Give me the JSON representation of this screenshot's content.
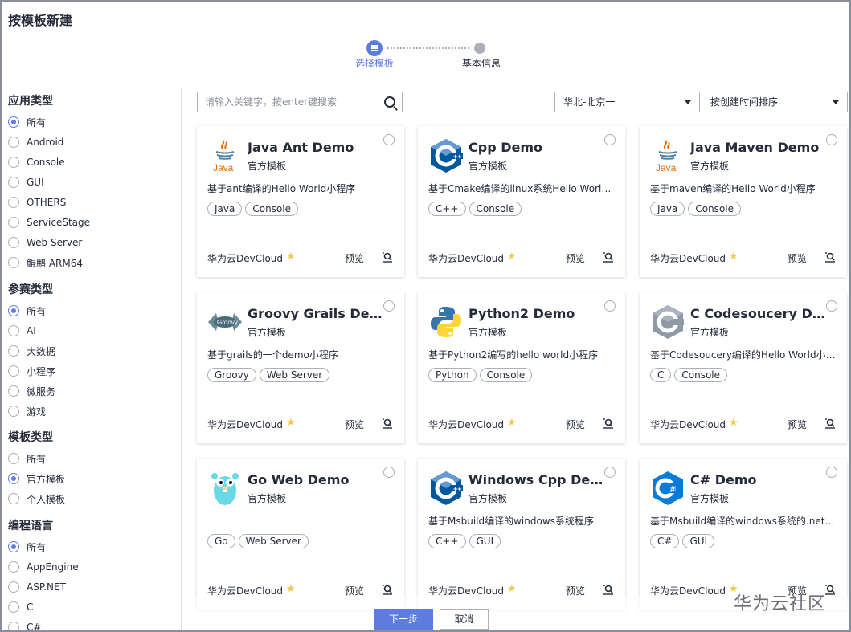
{
  "page_title": "按模板新建",
  "stepper": {
    "step1": "选择模板",
    "step2": "基本信息"
  },
  "sidebar": {
    "groups": [
      {
        "title": "应用类型",
        "items": [
          {
            "label": "所有",
            "checked": true
          },
          {
            "label": "Android",
            "checked": false
          },
          {
            "label": "Console",
            "checked": false
          },
          {
            "label": "GUI",
            "checked": false
          },
          {
            "label": "OTHERS",
            "checked": false
          },
          {
            "label": "ServiceStage",
            "checked": false
          },
          {
            "label": "Web Server",
            "checked": false
          },
          {
            "label": "鲲鹏 ARM64",
            "checked": false
          }
        ]
      },
      {
        "title": "参赛类型",
        "items": [
          {
            "label": "所有",
            "checked": true
          },
          {
            "label": "AI",
            "checked": false
          },
          {
            "label": "大数据",
            "checked": false
          },
          {
            "label": "小程序",
            "checked": false
          },
          {
            "label": "微服务",
            "checked": false
          },
          {
            "label": "游戏",
            "checked": false
          }
        ]
      },
      {
        "title": "模板类型",
        "items": [
          {
            "label": "所有",
            "checked": false
          },
          {
            "label": "官方模板",
            "checked": true
          },
          {
            "label": "个人模板",
            "checked": false
          }
        ]
      },
      {
        "title": "编程语言",
        "items": [
          {
            "label": "所有",
            "checked": true
          },
          {
            "label": "AppEngine",
            "checked": false
          },
          {
            "label": "ASP.NET",
            "checked": false
          },
          {
            "label": "C",
            "checked": false
          },
          {
            "label": "C#",
            "checked": false
          }
        ]
      }
    ]
  },
  "toolbar": {
    "search_placeholder": "请输入关键字，按enter键搜索",
    "region": "华北-北京一",
    "sort": "按创建时间排序"
  },
  "cards": [
    {
      "title": "Java Ant Demo",
      "subtitle": "官方模板",
      "desc": "基于ant编译的Hello World小程序",
      "tags": [
        "Java",
        "Console"
      ],
      "provider": "华为云DevCloud",
      "preview": "预览",
      "logo": "java-logo-icon"
    },
    {
      "title": "Cpp Demo",
      "subtitle": "官方模板",
      "desc": "基于Cmake编译的linux系统Hello World小程序",
      "tags": [
        "C++",
        "Console"
      ],
      "provider": "华为云DevCloud",
      "preview": "预览",
      "logo": "cpp-logo-icon"
    },
    {
      "title": "Java Maven Demo",
      "subtitle": "官方模板",
      "desc": "基于maven编译的Hello World小程序",
      "tags": [
        "Java",
        "Console"
      ],
      "provider": "华为云DevCloud",
      "preview": "预览",
      "logo": "java-logo-icon"
    },
    {
      "title": "Groovy Grails Demo",
      "subtitle": "官方模板",
      "desc": "基于grails的一个demo小程序",
      "tags": [
        "Groovy",
        "Web Server"
      ],
      "provider": "华为云DevCloud",
      "preview": "预览",
      "logo": "groovy-logo-icon"
    },
    {
      "title": "Python2 Demo",
      "subtitle": "官方模板",
      "desc": "基于Python2编写的hello world小程序",
      "tags": [
        "Python",
        "Console"
      ],
      "provider": "华为云DevCloud",
      "preview": "预览",
      "logo": "python-logo-icon"
    },
    {
      "title": "C Codesoucery Demo",
      "subtitle": "官方模板",
      "desc": "基于Codesoucery编译的Hello World小程序",
      "tags": [
        "C",
        "Console"
      ],
      "provider": "华为云DevCloud",
      "preview": "预览",
      "logo": "c-logo-icon"
    },
    {
      "title": "Go Web Demo",
      "subtitle": "官方模板",
      "desc": "",
      "tags": [
        "Go",
        "Web Server"
      ],
      "provider": "华为云DevCloud",
      "preview": "预览",
      "logo": "gopher-logo-icon"
    },
    {
      "title": "Windows Cpp Demo",
      "subtitle": "官方模板",
      "desc": "基于Msbuild编译的windows系统程序",
      "tags": [
        "C++",
        "GUI"
      ],
      "provider": "华为云DevCloud",
      "preview": "预览",
      "logo": "cpp-logo-icon"
    },
    {
      "title": "C# Demo",
      "subtitle": "官方模板",
      "desc": "基于Msbuild编译的windows系统的.net窗体程序",
      "tags": [
        "C#",
        "GUI"
      ],
      "provider": "华为云DevCloud",
      "preview": "预览",
      "logo": "csharp-logo-icon"
    }
  ],
  "footer": {
    "next": "下一步",
    "cancel": "取消"
  },
  "watermark": "华为云社区",
  "colors": {
    "accent": "#5e7ce0",
    "star": "#f2c94c",
    "border": "#adb0b8"
  }
}
